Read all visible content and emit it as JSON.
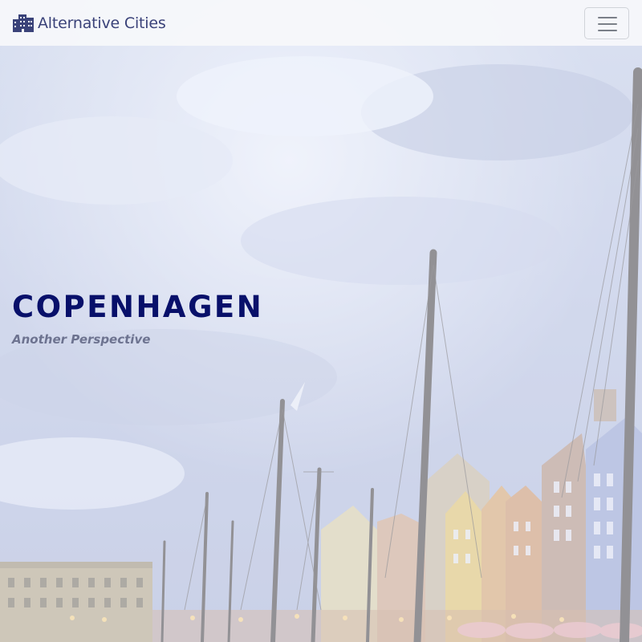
{
  "navbar": {
    "brand": {
      "icon": "city-buildings-icon",
      "label": "Alternative Cities"
    },
    "toggler": {
      "icon": "hamburger-menu-icon",
      "aria_label": "Toggle navigation"
    }
  },
  "hero": {
    "background": "Nyhavn harbour photo",
    "title": "COPENHAGEN",
    "subtitle": "Another Perspective"
  },
  "colors": {
    "brand_text": "#3a4279",
    "title": "#08106a",
    "subtitle": "#6d7390",
    "navbar_bg": "#f6f7fa"
  }
}
